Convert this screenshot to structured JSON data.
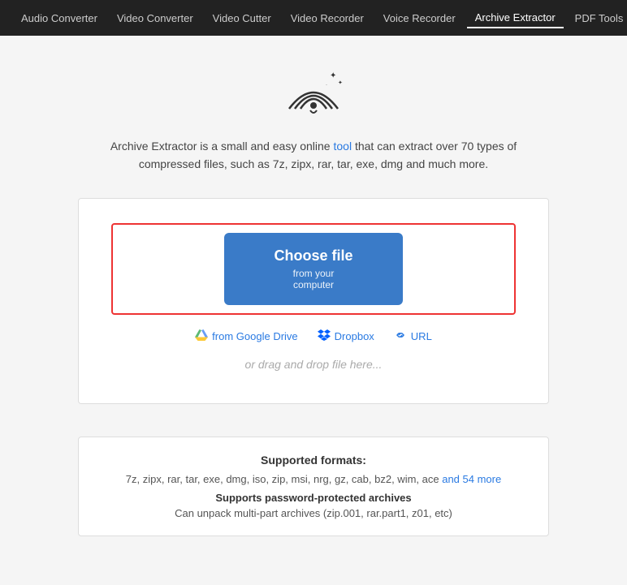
{
  "navbar": {
    "items": [
      {
        "label": "Audio Converter",
        "active": false
      },
      {
        "label": "Video Converter",
        "active": false
      },
      {
        "label": "Video Cutter",
        "active": false
      },
      {
        "label": "Video Recorder",
        "active": false
      },
      {
        "label": "Voice Recorder",
        "active": false
      },
      {
        "label": "Archive Extractor",
        "active": true
      },
      {
        "label": "PDF Tools",
        "active": false
      }
    ]
  },
  "main": {
    "description_text": "Archive Extractor is a small and easy online tool that can extract over 70 types of compressed files, such as 7z, zipx, rar, tar, exe, dmg and much more.",
    "description_link_text": "tool",
    "choose_file": {
      "main_label": "Choose file",
      "sub_label": "from your computer"
    },
    "sources": [
      {
        "label": "from Google Drive",
        "icon": "drive"
      },
      {
        "label": "Dropbox",
        "icon": "dropbox"
      },
      {
        "label": "URL",
        "icon": "link"
      }
    ],
    "drag_drop": "or drag and drop file here..."
  },
  "formats": {
    "title": "Supported formats:",
    "list": "7z, zipx, rar, tar, exe, dmg, iso, zip, msi, nrg, gz, cab, bz2, wim, ace",
    "more_link": "and 54 more",
    "feature1": "Supports password-protected archives",
    "feature2": "Can unpack multi-part archives (zip.001, rar.part1, z01, etc)"
  }
}
